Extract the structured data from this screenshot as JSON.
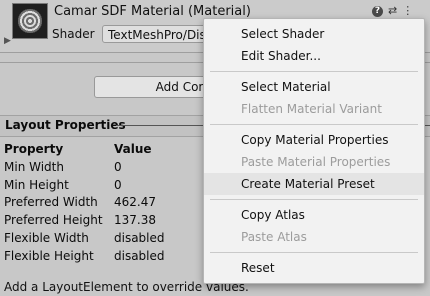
{
  "material": {
    "title": "Camar SDF Material (Material)",
    "shader_label": "Shader",
    "shader_value": "TextMeshPro/Distance Field"
  },
  "header_icons": [
    "help-icon",
    "presets-icon",
    "more-vertical-icon"
  ],
  "add_component_label": "Add Component",
  "layout": {
    "title": "Layout Properties",
    "col_property": "Property",
    "col_value": "Value",
    "rows": [
      {
        "k": "Min Width",
        "v": "0"
      },
      {
        "k": "Min Height",
        "v": "0"
      },
      {
        "k": "Preferred Width",
        "v": "462.47"
      },
      {
        "k": "Preferred Height",
        "v": "137.38"
      },
      {
        "k": "Flexible Width",
        "v": "disabled"
      },
      {
        "k": "Flexible Height",
        "v": "disabled"
      }
    ],
    "note": "Add a LayoutElement to override values."
  },
  "menu": {
    "items": [
      {
        "label": "Select Shader",
        "disabled": false
      },
      {
        "label": "Edit Shader...",
        "disabled": false
      },
      {
        "label": "Select Material",
        "disabled": false
      },
      {
        "label": "Flatten Material Variant",
        "disabled": true
      },
      {
        "label": "Copy Material Properties",
        "disabled": false
      },
      {
        "label": "Paste Material Properties",
        "disabled": true
      },
      {
        "label": "Create Material Preset",
        "disabled": false
      },
      {
        "label": "Copy Atlas",
        "disabled": false
      },
      {
        "label": "Paste Atlas",
        "disabled": true
      },
      {
        "label": "Reset",
        "disabled": false
      }
    ]
  }
}
